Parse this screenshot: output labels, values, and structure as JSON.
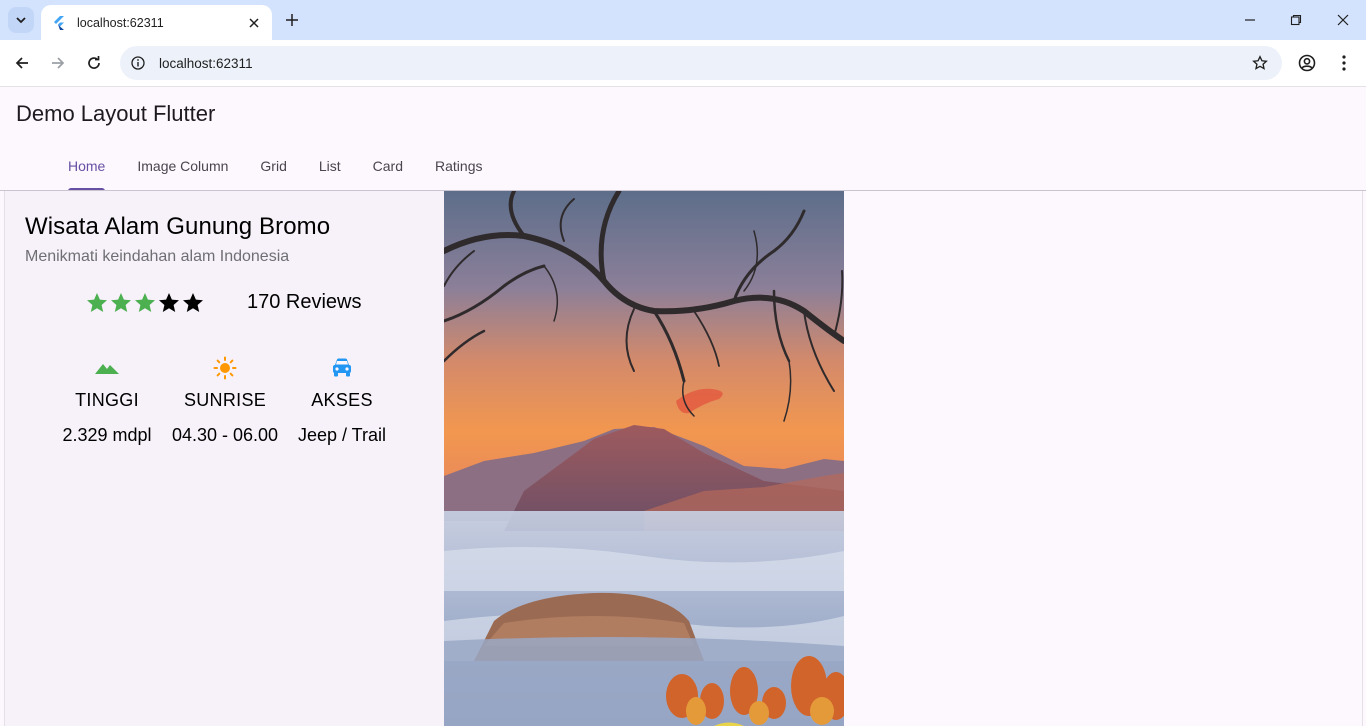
{
  "browser": {
    "tab_title": "localhost:62311",
    "url": "localhost:62311"
  },
  "app": {
    "title": "Demo Layout Flutter",
    "tabs": [
      {
        "label": "Home",
        "active": true
      },
      {
        "label": "Image Column",
        "active": false
      },
      {
        "label": "Grid",
        "active": false
      },
      {
        "label": "List",
        "active": false
      },
      {
        "label": "Card",
        "active": false
      },
      {
        "label": "Ratings",
        "active": false
      }
    ]
  },
  "place": {
    "title": "Wisata Alam Gunung Bromo",
    "subtitle": "Menikmati keindahan alam Indonesia",
    "rating": {
      "value": 3,
      "max": 5,
      "filled_color": "#4caf50",
      "empty_color": "#000000"
    },
    "reviews": "170 Reviews",
    "info": [
      {
        "icon": "landscape-icon",
        "label": "TINGGI",
        "value": "2.329 mdpl",
        "color": "#4caf50"
      },
      {
        "icon": "sun-icon",
        "label": "SUNRISE",
        "value": "04.30 - 06.00",
        "color": "#ff9800"
      },
      {
        "icon": "car-icon",
        "label": "AKSES",
        "value": "Jeep / Trail",
        "color": "#2196f3"
      }
    ]
  },
  "colors": {
    "accent": "#6750a4",
    "chrome_tabstrip": "#d3e3fd",
    "app_background": "#fdf7fe"
  }
}
